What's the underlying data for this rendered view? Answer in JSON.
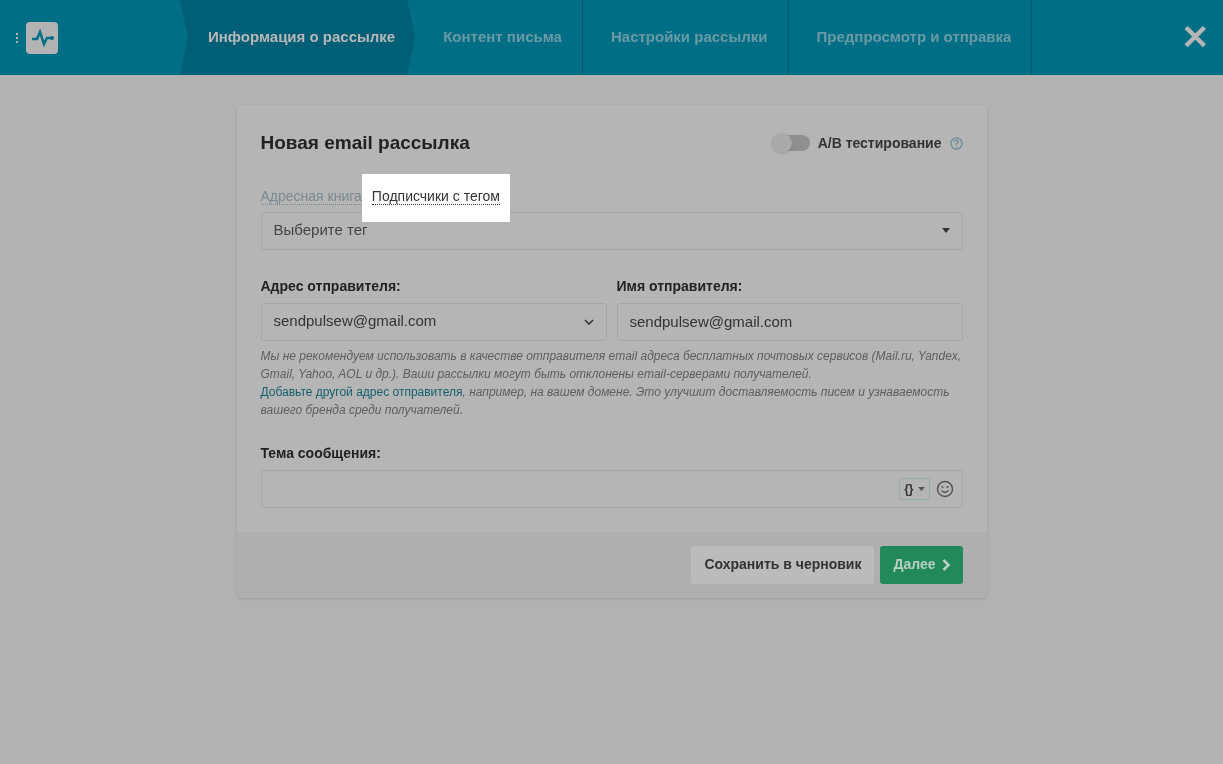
{
  "header": {
    "steps": [
      {
        "label": "Информация о рассылке",
        "selected": true
      },
      {
        "label": "Контент письма",
        "selected": false
      },
      {
        "label": "Настройки рассылки",
        "selected": false
      },
      {
        "label": "Предпросмотр и отправка",
        "selected": false
      }
    ],
    "close": "✕"
  },
  "form": {
    "title": "Новая email рассылка",
    "ab_test": {
      "label": "A/B тестирование",
      "on": false
    },
    "source_tabs": [
      {
        "label": "Адресная книга",
        "selected": false
      },
      {
        "label": "Подписчики с тегом",
        "selected": true
      }
    ],
    "tag_select": {
      "placeholder": "Выберите тег"
    },
    "sender_address": {
      "label": "Адрес отправителя:",
      "value": "sendpulsew@gmail.com"
    },
    "sender_name": {
      "label": "Имя отправителя:",
      "value": "sendpulsew@gmail.com"
    },
    "hint": [
      {
        "kind": "text",
        "text": "Мы не рекомендуем использовать в качестве отправителя email адреса бесплатных почтовых сервисов (Mail.ru, Yandex, Gmail, Yahoo, AOL и др.). Ваши рассылки могут быть отклонены email-серверами получателей. "
      },
      {
        "kind": "link",
        "text": "Добавьте другой адрес отправителя"
      },
      {
        "kind": "text",
        "text": ", например, на вашем домене. Это улучшит доставляемость писем и узнаваемость вашего бренда среди получателей."
      }
    ],
    "subject": {
      "label": "Тема сообщения:",
      "variable_button": "{}"
    },
    "buttons": {
      "save_draft": "Сохранить в черновик",
      "next": "Далее"
    }
  }
}
